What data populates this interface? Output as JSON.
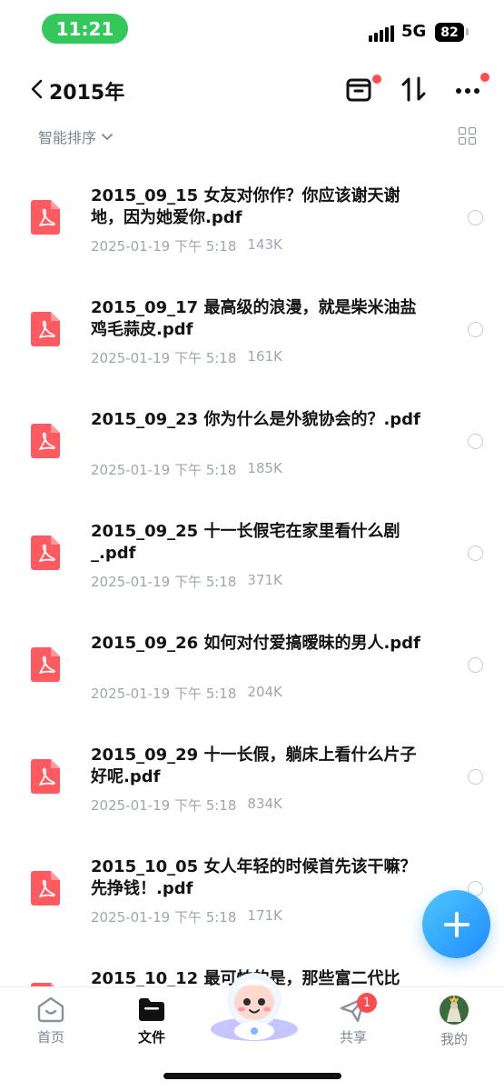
{
  "status_bar": {
    "time": "11:21",
    "network": "5G",
    "battery": "82"
  },
  "nav": {
    "title": "2015年",
    "back_icon": "chevron-left-icon"
  },
  "sort": {
    "label": "智能排序",
    "icon": "chevron-down-icon"
  },
  "files": [
    {
      "name": "2015_09_15 女友对你作？你应该谢天谢地，因为她爱你.pdf",
      "date": "2025-01-19 下午 5:18",
      "size": "143K"
    },
    {
      "name": "2015_09_17 最高级的浪漫，就是柴米油盐鸡毛蒜皮.pdf",
      "date": "2025-01-19 下午 5:18",
      "size": "161K"
    },
    {
      "name": "2015_09_23 你为什么是外貌协会的？.pdf",
      "date": "2025-01-19 下午 5:18",
      "size": "185K"
    },
    {
      "name": "2015_09_25 十一长假宅在家里看什么剧_.pdf",
      "date": "2025-01-19 下午 5:18",
      "size": "371K"
    },
    {
      "name": "2015_09_26 如何对付爱搞暧昧的男人.pdf",
      "date": "2025-01-19 下午 5:18",
      "size": "204K"
    },
    {
      "name": "2015_09_29 十一长假，躺床上看什么片子好呢.pdf",
      "date": "2025-01-19 下午 5:18",
      "size": "834K"
    },
    {
      "name": "2015_10_05 女人年轻的时候首先该干嘛？先挣钱！.pdf",
      "date": "2025-01-19 下午 5:18",
      "size": "171K"
    },
    {
      "name": "2015_10_12 最可怕的是，那些富二代比",
      "date": "",
      "size": ""
    }
  ],
  "tabs": [
    {
      "label": "首页",
      "icon": "home-icon"
    },
    {
      "label": "文件",
      "icon": "folder-icon"
    },
    {
      "label": "共享",
      "icon": "send-icon",
      "badge": "1"
    },
    {
      "label": "我的",
      "icon": "avatar-icon"
    }
  ],
  "colors": {
    "accent": "#1e8cff",
    "pdf": "#ff5a5f",
    "status_green": "#34c759",
    "badge_red": "#ff4d4f"
  }
}
